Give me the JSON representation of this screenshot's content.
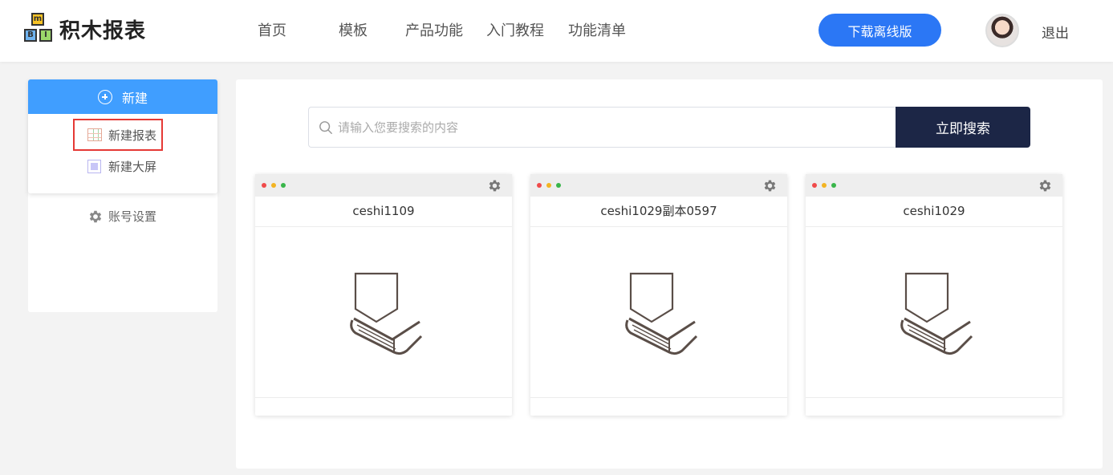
{
  "header": {
    "logo": {
      "blocks": [
        "m",
        "B",
        "I"
      ],
      "text": "积木报表"
    },
    "nav": [
      {
        "label": "首页"
      },
      {
        "label": "模板"
      },
      {
        "label": "产品功能"
      },
      {
        "label": "入门教程"
      },
      {
        "label": "功能清单"
      }
    ],
    "download_label": "下载离线版",
    "logout_label": "退出"
  },
  "sidebar": {
    "new_label": "新建",
    "new_report_label": "新建报表",
    "new_screen_label": "新建大屏",
    "account_label": "账号设置"
  },
  "search": {
    "placeholder": "请输入您要搜索的内容",
    "button_label": "立即搜索"
  },
  "cards": [
    {
      "title": "ceshi1109"
    },
    {
      "title": "ceshi1029副本0597"
    },
    {
      "title": "ceshi1029"
    }
  ],
  "colors": {
    "primary": "#409eff",
    "download": "#2b77f5",
    "search_button": "#1c2646",
    "highlight_border": "#e53935"
  },
  "icons": {
    "new": "plus-circle-icon",
    "report": "table-icon",
    "screen": "screen-icon",
    "account": "gear-icon",
    "search": "search-icon",
    "card_settings": "gear-icon",
    "card_thumbnail": "book-logo-icon"
  }
}
